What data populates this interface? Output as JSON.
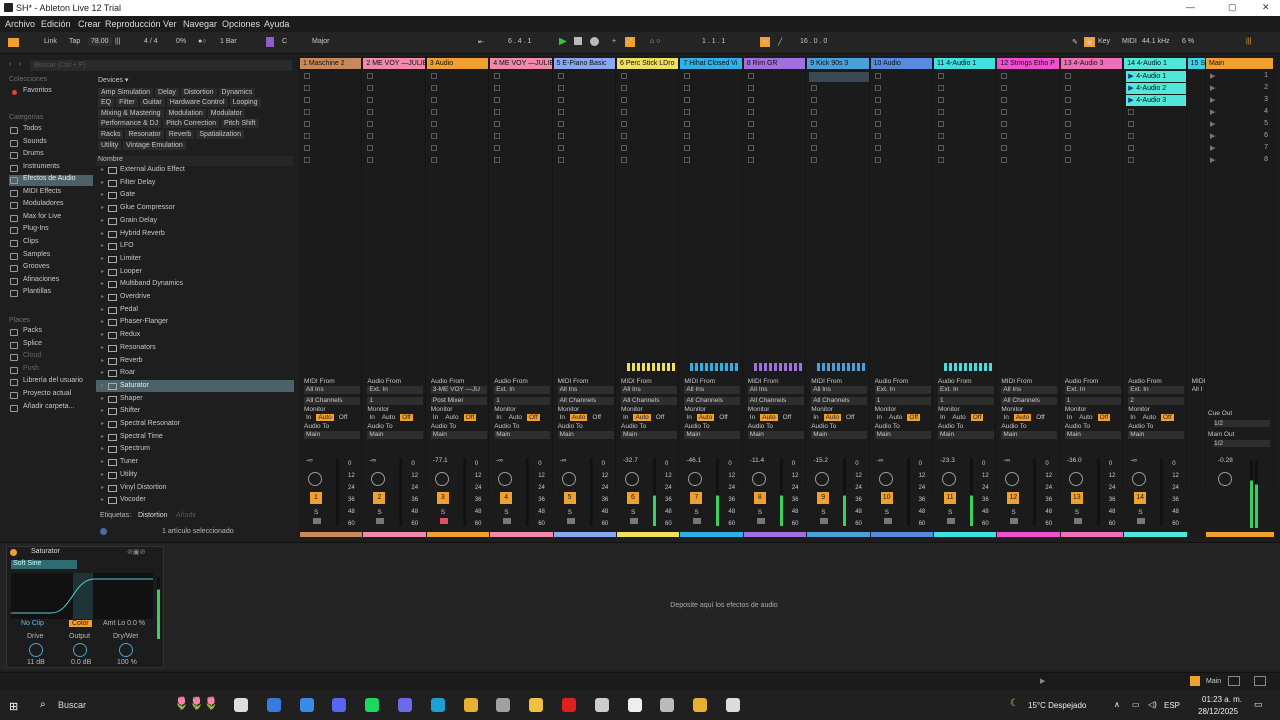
{
  "window": {
    "title": "SH* - Ableton Live 12 Trial"
  },
  "menu": [
    "Archivo",
    "Edición",
    "Crear",
    "Reproducción",
    "Ver",
    "Navegar",
    "Opciones",
    "Ayuda"
  ],
  "transport": {
    "link": "Link",
    "tap": "Tap",
    "tempo": "78.00",
    "time_signature": "4 / 4",
    "groove": "0%",
    "quantize": "1 Bar",
    "scale_icon": "⫶",
    "root": "C",
    "scale": "Major",
    "position": "6 .   4 .   1",
    "loop_start": "1 .   1 .   1",
    "loop_length": "16 .   0 .   0",
    "key": "Key",
    "midi": "MIDI",
    "sample_rate": "44.1 kHz",
    "cpu": "6 %"
  },
  "browser": {
    "search_placeholder": "Buscar (Ctrl + F)",
    "collections_heading": "Colecciones",
    "favorites": "Favoritos",
    "categories_heading": "Categorías",
    "categories": [
      "Todos",
      "Sounds",
      "Drums",
      "Instruments",
      "Efectos de Audio",
      "MIDI Effects",
      "Moduladores",
      "Max for Live",
      "Plug-Ins",
      "Clips",
      "Samples",
      "Grooves",
      "Afinaciones",
      "Plantillas"
    ],
    "places_heading": "Places",
    "places": [
      "Packs",
      "Splice",
      "Cloud",
      "Push",
      "Librería del usuario",
      "Proyecto actual",
      "Añadir carpeta..."
    ],
    "devices_heading": "Devices ▾",
    "tags": [
      "Amp Simulation",
      "Delay",
      "Distortion",
      "Dynamics",
      "EQ",
      "Filter",
      "Guitar",
      "Hardware Control",
      "Looping",
      "Mixing & Mastering",
      "Modulation",
      "Modulator",
      "Performance & DJ",
      "Pitch Correction",
      "Pitch Shift",
      "Racks",
      "Resonator",
      "Reverb",
      "Spatialization",
      "Utility",
      "Vintage Emulation",
      "Vocal"
    ],
    "list_header": "Nombre",
    "items": [
      "External Audio Effect",
      "Filter Delay",
      "Gate",
      "Glue Compressor",
      "Grain Delay",
      "Hybrid Reverb",
      "LFO",
      "Limiter",
      "Looper",
      "Multiband Dynamics",
      "Overdrive",
      "Pedal",
      "Phaser-Flanger",
      "Redux",
      "Resonators",
      "Reverb",
      "Roar",
      "Saturator",
      "Shaper",
      "Shifter",
      "Spectral Resonator",
      "Spectral Time",
      "Spectrum",
      "Tuner",
      "Utility",
      "Vinyl Distortion",
      "Vocoder"
    ],
    "selected_item": "Saturator",
    "footer_tags_label": "Etiquetas:",
    "footer_tag": "Distortion",
    "footer_add": "Añadir",
    "status": "1 artículo seleccionado"
  },
  "tracks": [
    {
      "name": "1 Maschine 2",
      "color": "#c88a5a",
      "num": "1",
      "in_label": "MIDI From",
      "in_src": "All Ins",
      "in_ch": "All Channels",
      "mon_active": "Auto",
      "vol": "-∞",
      "playing": false
    },
    {
      "name": "2 ME VOY —JULIE",
      "color": "#f08aa8",
      "num": "2",
      "in_label": "Audio From",
      "in_src": "Ext. In",
      "in_ch": "1",
      "mon_active": "Off",
      "vol": "-∞",
      "playing": false
    },
    {
      "name": "3 Audio",
      "color": "#f0a030",
      "num": "3",
      "in_label": "Audio From",
      "in_src": "3-ME VOY —JU",
      "in_ch": "Post Mixer",
      "mon_active": "Off",
      "vol": "-77.1",
      "playing": false
    },
    {
      "name": "4 ME VOY —JULIE",
      "color": "#f08aa8",
      "num": "4",
      "in_label": "Audio From",
      "in_src": "Ext. In",
      "in_ch": "1",
      "mon_active": "Off",
      "vol": "-∞",
      "playing": false
    },
    {
      "name": "5 E-Piano Basic",
      "color": "#8aa8f0",
      "num": "5",
      "in_label": "MIDI From",
      "in_src": "All Ins",
      "in_ch": "All Channels",
      "mon_active": "Auto",
      "vol": "-∞",
      "playing": false
    },
    {
      "name": "6 Perc Stick LDro",
      "color": "#f0e060",
      "num": "6",
      "in_label": "MIDI From",
      "in_src": "All Ins",
      "in_ch": "All Channels",
      "mon_active": "Auto",
      "vol": "-32.7",
      "playing": true
    },
    {
      "name": "7 Hihat Closed Vi",
      "color": "#30b0e8",
      "num": "7",
      "in_label": "MIDI From",
      "in_src": "All Ins",
      "in_ch": "All Channels",
      "mon_active": "Auto",
      "vol": "-46.1",
      "playing": true
    },
    {
      "name": "8 Rim GR",
      "color": "#a070e0",
      "num": "8",
      "in_label": "MIDI From",
      "in_src": "All Ins",
      "in_ch": "All Channels",
      "mon_active": "Auto",
      "vol": "-11.4",
      "playing": true
    },
    {
      "name": "9 Kick 90s 3",
      "color": "#4aa0d8",
      "num": "9",
      "in_label": "MIDI From",
      "in_src": "All Ins",
      "in_ch": "All Channels",
      "mon_active": "Auto",
      "vol": "-15.2",
      "playing": true
    },
    {
      "name": "10 Audio",
      "color": "#5a8ae0",
      "num": "10",
      "in_label": "Audio From",
      "in_src": "Ext. In",
      "in_ch": "1",
      "mon_active": "Off",
      "vol": "-∞",
      "playing": false
    },
    {
      "name": "11 4-Audio 1",
      "color": "#40e0e0",
      "num": "11",
      "in_label": "Audio From",
      "in_src": "Ext. In",
      "in_ch": "1",
      "mon_active": "Off",
      "vol": "-23.3",
      "playing": true
    },
    {
      "name": "12 Strings Etho P",
      "color": "#f050d0",
      "num": "12",
      "in_label": "MIDI From",
      "in_src": "All Ins",
      "in_ch": "All Channels",
      "mon_active": "Auto",
      "vol": "-∞",
      "playing": false
    },
    {
      "name": "13 4-Audio 3",
      "color": "#f070b8",
      "num": "13",
      "in_label": "Audio From",
      "in_src": "Ext. In",
      "in_ch": "1",
      "mon_active": "Off",
      "vol": "-36.0",
      "playing": false
    },
    {
      "name": "14 4-Audio 1",
      "color": "#50e8d8",
      "num": "14",
      "in_label": "Audio From",
      "in_src": "Ext. In",
      "in_ch": "2",
      "mon_active": "Off",
      "vol": "-∞",
      "playing": false
    },
    {
      "name": "15 S",
      "color": "#40d0e8",
      "num": "15",
      "in_label": "MIDI",
      "in_src": "All I",
      "in_ch": "All",
      "mon_active": "",
      "vol": "",
      "playing": false
    }
  ],
  "clips_track14": [
    "4-Audio 1",
    "4-Audio 2",
    "4-Audio 3"
  ],
  "mixer_labels": {
    "monitor": "Monitor",
    "in": "In",
    "auto": "Auto",
    "off": "Off",
    "audio_to": "Audio To",
    "main": "Main",
    "solo": "S"
  },
  "meter_scale": [
    "0",
    "12",
    "24",
    "36",
    "48",
    "60"
  ],
  "scenes": [
    "1",
    "2",
    "3",
    "4",
    "5",
    "6",
    "7",
    "8"
  ],
  "master": {
    "name": "Main",
    "cue_out": "Cue Out",
    "cue_out_value": "1/2",
    "main_out": "Main Out",
    "main_out_value": "1/2",
    "volume": "-0.28"
  },
  "device": {
    "name": "Saturator",
    "curve_type": "Soft Sine",
    "clip_mode": "No Clip",
    "color_label": "Color",
    "amt_lo": "Amt Lo  0.0 %",
    "drive_label": "Drive",
    "output_label": "Output",
    "drywet_label": "Dry/Wet",
    "drive": "11 dB",
    "output": "0.0 dB",
    "drywet": "100 %",
    "drop_hint": "Deposite aquí los efectos de audio"
  },
  "status": {
    "main": "Main"
  },
  "taskbar": {
    "search": "Buscar",
    "weather": "15°C  Despejado",
    "lang": "ESP",
    "time": "01:23 a. m.",
    "date": "28/12/2025"
  },
  "taskbar_icons": [
    {
      "name": "task-view-icon",
      "color": "#dddddd"
    },
    {
      "name": "mail-icon",
      "color": "#3a7ae0"
    },
    {
      "name": "store-icon",
      "color": "#3a8ae8"
    },
    {
      "name": "discord-icon",
      "color": "#5865f2"
    },
    {
      "name": "spotify-icon",
      "color": "#1ed760"
    },
    {
      "name": "teams-icon",
      "color": "#6a6ae8"
    },
    {
      "name": "edge-icon",
      "color": "#20a0d0"
    },
    {
      "name": "chrome-icon",
      "color": "#e8b030"
    },
    {
      "name": "sticker-icon",
      "color": "#a0a0a0"
    },
    {
      "name": "files-icon",
      "color": "#f0c040"
    },
    {
      "name": "opera-icon",
      "color": "#e02020"
    },
    {
      "name": "settings-icon",
      "color": "#cccccc"
    },
    {
      "name": "capcut-icon",
      "color": "#eeeeee"
    },
    {
      "name": "obs-icon",
      "color": "#bbbbbb"
    },
    {
      "name": "chrome-icon-2",
      "color": "#e8b030"
    },
    {
      "name": "ableton-icon",
      "color": "#dddddd"
    }
  ]
}
